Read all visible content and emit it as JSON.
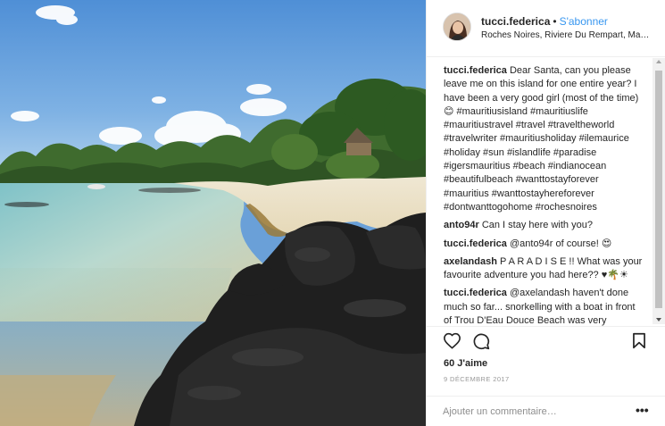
{
  "post": {
    "image_alt": "Rocky beach with turquoise water under blue sky",
    "username": "tucci.federica",
    "separator": "•",
    "follow_label": "S'abonner",
    "location": "Roches Noires, Riviere Du Rempart, Mauritius"
  },
  "comments": [
    {
      "user": "tucci.federica",
      "text": "Dear Santa, can you please leave me on this island for one entire year? I have been a very good girl (most of the time)😊 #mauritiusisland #mauritiuslife #mauritiustravel #travel #traveltheworld #travelwriter #mauritiusholiday #ilemaurice #holiday #sun #islandlife #paradise #igersmauritius #beach #indianocean #beautifulbeach #wanttostayforever #mauritius #wanttostayhereforever #dontwanttogohome #rochesnoires"
    },
    {
      "user": "anto94r",
      "text": "Can I stay here with you?"
    },
    {
      "user": "tucci.federica",
      "text": "@anto94r of course! 😍"
    },
    {
      "user": "axelandash",
      "text": "P A R A D I S E !! What was your favourite adventure you had here?? ♥🌴☀"
    },
    {
      "user": "tucci.federica",
      "text": "@axelandash haven't done much so far... snorkelling with a boat in front of Trou D'Eau Douce Beach was very"
    }
  ],
  "actions": {
    "like_icon": "heart-icon",
    "comment_icon": "comment-icon",
    "save_icon": "bookmark-icon",
    "likes_text": "60 J'aime",
    "date_text": "9 DÉCEMBRE 2017"
  },
  "add_comment": {
    "placeholder": "Ajouter un commentaire…",
    "more_label": "•••"
  },
  "colors": {
    "link_blue": "#3897f0",
    "text": "#262626",
    "muted": "#8e8e8e",
    "border": "#efefef"
  }
}
